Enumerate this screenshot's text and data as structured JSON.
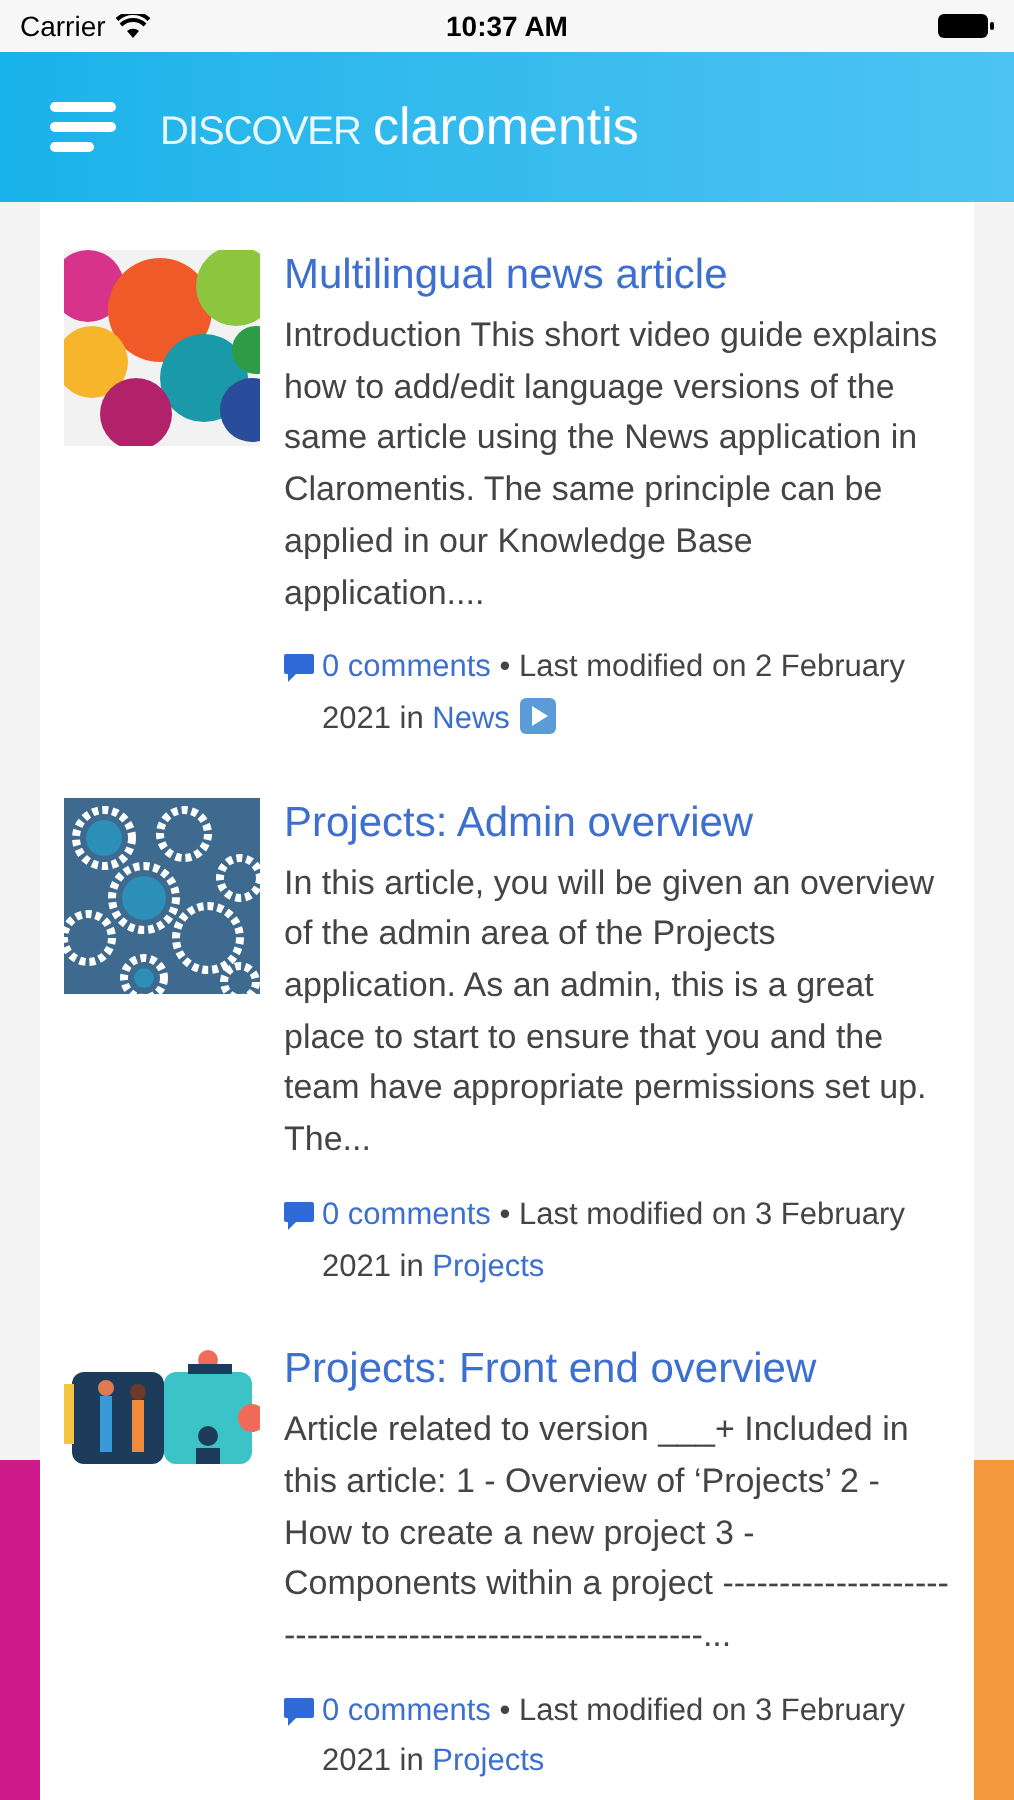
{
  "status_bar": {
    "carrier": "Carrier",
    "time": "10:37 AM"
  },
  "header": {
    "brand_prefix": "DISCOVER",
    "brand_name": "claromentis"
  },
  "articles": [
    {
      "kind": "languages",
      "title": "Multilingual news article",
      "excerpt": "Introduction This short video guide explains how to add/edit language versions of the same article using the News application in Claromentis. The same principle can be applied in our Knowledge Base application....",
      "comments": "0 comments",
      "modified": " • Last modified on 2 February 2021 in ",
      "category": "News",
      "video": true
    },
    {
      "kind": "gears",
      "title": "Projects: Admin overview",
      "excerpt": "In this article, you will be given an overview of the admin area of the Projects application. As an admin, this is a great place to start to ensure that you and the team have appropriate permissions set up. The...",
      "comments": "0 comments",
      "modified": " • Last modified on 3 February 2021 in ",
      "category": "Projects",
      "video": false
    },
    {
      "kind": "puzzle",
      "title": "Projects: Front end overview",
      "excerpt": "Article related to version ___+ Included in this article: 1 - Overview of ‘Projects’ 2 - How to create a new project 3 - Components within a project ---------------------------------------------------------...",
      "comments": "0 comments",
      "modified": " • Last modified on 3 February 2021 in ",
      "category": "Projects",
      "video": false
    }
  ]
}
